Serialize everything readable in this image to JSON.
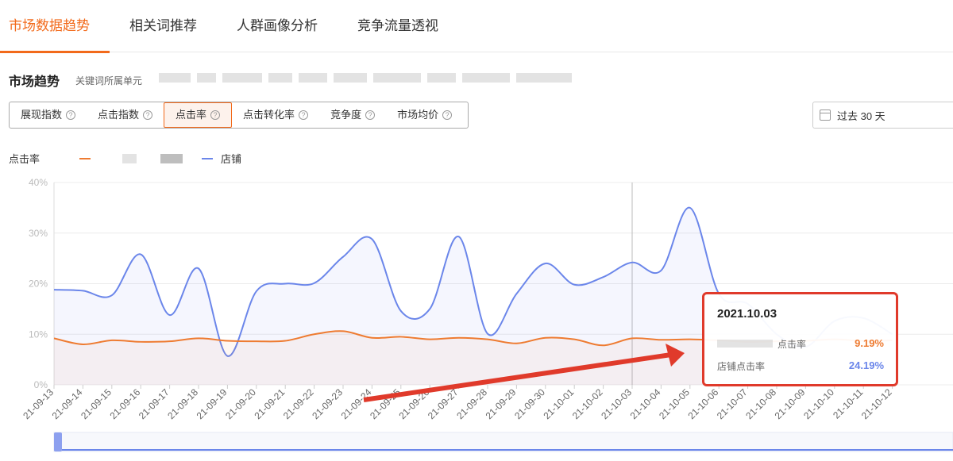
{
  "tabs": [
    {
      "label": "市场数据趋势",
      "active": true
    },
    {
      "label": "相关词推荐",
      "active": false
    },
    {
      "label": "人群画像分析",
      "active": false
    },
    {
      "label": "竞争流量透视",
      "active": false
    }
  ],
  "section": {
    "title": "市场趋势",
    "subtitle": "关键词所属单元"
  },
  "metrics": [
    {
      "label": "展现指数",
      "active": false
    },
    {
      "label": "点击指数",
      "active": false
    },
    {
      "label": "点击率",
      "active": true
    },
    {
      "label": "点击转化率",
      "active": false
    },
    {
      "label": "竞争度",
      "active": false
    },
    {
      "label": "市场均价",
      "active": false
    }
  ],
  "date_range": "过去 30 天",
  "legend": {
    "metric_label": "点击率",
    "series_market": "",
    "series_store": "店铺"
  },
  "tooltip": {
    "date": "2021.10.03",
    "row1_label": "点击率",
    "row1_value": "9.19%",
    "row2_label": "店铺点击率",
    "row2_value": "24.19%"
  },
  "colors": {
    "accent": "#f26a1b",
    "market_line": "#ee7b31",
    "store_line": "#6b86ea",
    "highlight": "#e03a2b"
  },
  "chart_data": {
    "type": "line",
    "x": [
      "21-09-13",
      "21-09-14",
      "21-09-15",
      "21-09-16",
      "21-09-17",
      "21-09-18",
      "21-09-19",
      "21-09-20",
      "21-09-21",
      "21-09-22",
      "21-09-23",
      "21-09-24",
      "21-09-25",
      "21-09-26",
      "21-09-27",
      "21-09-28",
      "21-09-29",
      "21-09-30",
      "21-10-01",
      "21-10-02",
      "21-10-03",
      "21-10-04",
      "21-10-05",
      "21-10-06",
      "21-10-07",
      "21-10-08",
      "21-10-09",
      "21-10-10",
      "21-10-11",
      "21-10-12"
    ],
    "ylim": [
      0,
      40
    ],
    "yticks": [
      "0%",
      "10%",
      "20%",
      "30%",
      "40%"
    ],
    "series": [
      {
        "name": "",
        "color": "#ee7b31",
        "values": [
          9.2,
          8.0,
          8.8,
          8.5,
          8.6,
          9.2,
          8.7,
          8.6,
          8.7,
          10.0,
          10.6,
          9.3,
          9.5,
          9.0,
          9.3,
          9.0,
          8.2,
          9.3,
          9.0,
          7.8,
          9.19,
          8.9,
          9.0,
          8.8,
          8.5,
          8.6,
          8.7,
          9.0,
          8.7,
          8.8
        ]
      },
      {
        "name": "店铺",
        "color": "#6b86ea",
        "values": [
          18.8,
          18.6,
          17.7,
          25.8,
          13.8,
          23.0,
          5.7,
          18.5,
          20.0,
          20.1,
          25.3,
          28.8,
          14.6,
          15.0,
          29.3,
          10.1,
          18.0,
          24.0,
          19.8,
          21.3,
          24.19,
          22.6,
          35.0,
          18.0,
          16.0,
          10.0,
          7.5,
          12.6,
          13.2,
          10.0
        ]
      }
    ]
  }
}
